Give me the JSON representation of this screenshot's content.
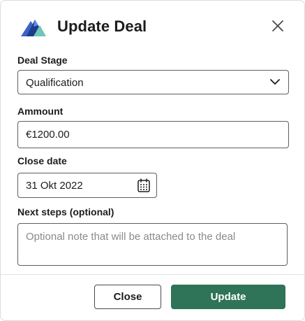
{
  "dialog": {
    "title": "Update Deal",
    "close_icon": "close-icon"
  },
  "fields": {
    "deal_stage": {
      "label": "Deal Stage",
      "value": "Qualification",
      "icon": "chevron-down-icon"
    },
    "amount": {
      "label": "Ammount",
      "value": "€1200.00"
    },
    "close_date": {
      "label": "Close date",
      "value": "31 Okt 2022",
      "icon": "calendar-icon"
    },
    "next_steps": {
      "label": "Next steps (optional)",
      "placeholder": "Optional note that will be attached to the deal"
    }
  },
  "footer": {
    "close_label": "Close",
    "update_label": "Update"
  },
  "colors": {
    "primary": "#2f7358",
    "logo_dark": "#1e3a8a",
    "logo_mid": "#3b82f6",
    "logo_light": "#7dd3c0"
  }
}
